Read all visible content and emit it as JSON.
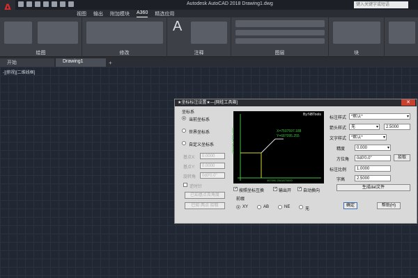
{
  "titlebar": {
    "app_title": "Autodesk AutoCAD 2018   Drawing1.dwg",
    "search_placeholder": "键入关键字或短语",
    "logo": "A"
  },
  "menu": [
    "视图",
    "输出",
    "附加模块",
    "A360",
    "精选应用"
  ],
  "ribbon": {
    "panels": [
      "绘图",
      "修改",
      "注释",
      "图层",
      "块"
    ]
  },
  "tabs": [
    "开始",
    "Drawing1"
  ],
  "canvas": {
    "view_label": "-][俯视][二维线框]"
  },
  "dialog": {
    "title": "★坐标标注设置★—[网蛙工具箱]",
    "coord_system": {
      "group": "坐标系",
      "options": [
        "当前坐标系",
        "世界坐标系",
        "自定义坐标系"
      ],
      "selected": 0
    },
    "base_x": {
      "label": "基点X:",
      "value": "0.0000"
    },
    "base_y": {
      "label": "基点Y:",
      "value": "0.0000"
    },
    "rotation": {
      "label": "旋转角",
      "value": "0d0'0.0\""
    },
    "clockwise": "逆时针",
    "pick_base_btn": "已知基点及角度",
    "pick_two_btn": "已知 两点 拾取",
    "preview": {
      "brand": "By:NBTools",
      "y_axis": "2562040.34589.0000",
      "x_axis": "467090.2541870000",
      "pt1": "X=7597597.188",
      "pt2": "Y=687095.255"
    },
    "checks": [
      {
        "label": "按照坐标互换",
        "checked": true
      },
      {
        "label": "输出开",
        "checked": true
      },
      {
        "label": "自动换向",
        "checked": true
      }
    ],
    "prefix": {
      "group": "前缀",
      "options": [
        "XY",
        "AB",
        "NE",
        "无"
      ],
      "selected": 0
    },
    "dim_style": {
      "label": "标注样式",
      "value": "*默认*"
    },
    "arrow_style": {
      "label": "箭头样式",
      "value": "无",
      "size": "2.5000"
    },
    "text_style": {
      "label": "文字样式",
      "value": "*默认*"
    },
    "precision": {
      "label": "精度",
      "value": "0.000"
    },
    "angle": {
      "label": "方位角",
      "value": "0d0'0.0\"",
      "pick": "拾取"
    },
    "scale": {
      "label": "标注比例",
      "value": "1.0000"
    },
    "text_height": {
      "label": "字高",
      "value": "2.5000"
    },
    "gen_btn": "生成dat文件",
    "ok_btn": "确定",
    "help_btn": "帮助(H)"
  }
}
